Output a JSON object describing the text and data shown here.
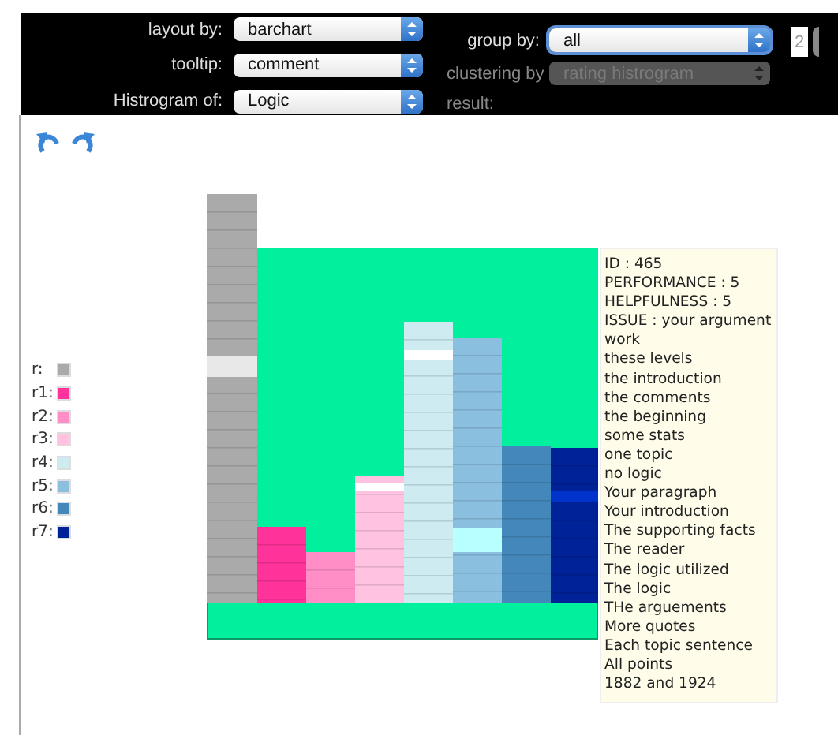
{
  "toolbar": {
    "left_controls": [
      {
        "label": "layout by:",
        "value": "barchart",
        "disabled": false,
        "focused": false
      },
      {
        "label": "tooltip:",
        "value": "comment",
        "disabled": false,
        "focused": false
      },
      {
        "label": "Histrogram of:",
        "value": "Logic",
        "disabled": false,
        "focused": false
      }
    ],
    "right_controls": [
      {
        "kind": "select",
        "label": "group by:",
        "value": "all",
        "disabled": false,
        "focused": true
      },
      {
        "kind": "select",
        "label": "clustering by",
        "value": "rating histrogram",
        "disabled": true,
        "focused": false
      },
      {
        "kind": "text",
        "label": "result:",
        "disabled": true
      }
    ],
    "count_field": {
      "value": "2"
    }
  },
  "legend": [
    {
      "label": "r:",
      "color": "#aaaaaa"
    },
    {
      "label": "r1:",
      "color": "#ff3399"
    },
    {
      "label": "r2:",
      "color": "#ff8ec6"
    },
    {
      "label": "r3:",
      "color": "#ffc2e0"
    },
    {
      "label": "r4:",
      "color": "#cdebf1"
    },
    {
      "label": "r5:",
      "color": "#8bbfe0"
    },
    {
      "label": "r6:",
      "color": "#4488bb"
    },
    {
      "label": "r7:",
      "color": "#002299"
    }
  ],
  "tooltip": {
    "lines": [
      "ID : 465",
      "PERFORMANCE : 5",
      "HELPFULNESS : 5",
      "ISSUE : your argument",
      "work",
      "these levels",
      "the introduction",
      "the comments",
      "the beginning",
      "some stats",
      "one topic",
      "no logic",
      "Your paragraph",
      "Your introduction",
      "The supporting facts",
      "The reader",
      "The logic utilized",
      "The logic",
      "THe arguements",
      "More quotes",
      "Each topic sentence",
      "All points",
      "1882 and 1924"
    ]
  }
}
